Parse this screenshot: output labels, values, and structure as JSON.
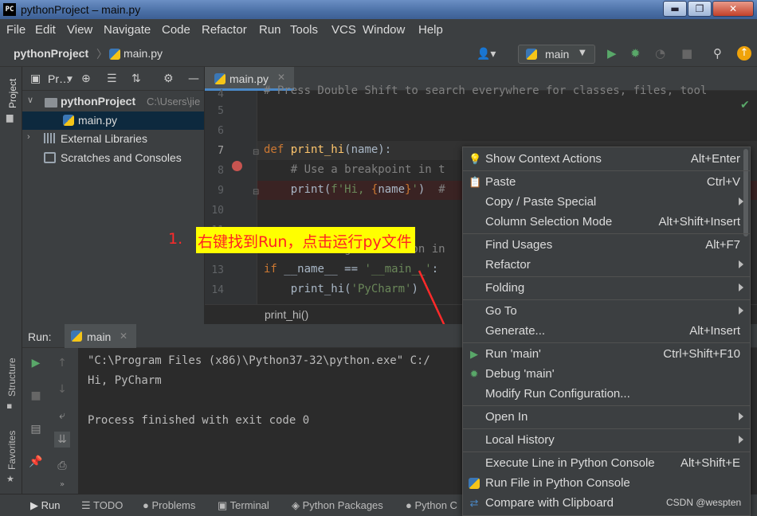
{
  "window": {
    "title": "pythonProject – main.py",
    "app_icon": "PC"
  },
  "menu": [
    "File",
    "Edit",
    "View",
    "Navigate",
    "Code",
    "Refactor",
    "Run",
    "Tools",
    "VCS",
    "Window",
    "Help"
  ],
  "navbar": {
    "project": "pythonProject",
    "file": "main.py",
    "run_config": "main"
  },
  "sidebar_tabs": {
    "project": "Project",
    "structure": "Structure",
    "favorites": "Favorites"
  },
  "project_panel": {
    "header": "Pr…",
    "tree": [
      {
        "label": "pythonProject",
        "detail": "C:\\Users\\jie",
        "type": "folder"
      },
      {
        "label": "main.py",
        "type": "python-file"
      },
      {
        "label": "External Libraries",
        "type": "libraries"
      },
      {
        "label": "Scratches and Consoles",
        "type": "scratches"
      }
    ]
  },
  "editor": {
    "tab": "main.py",
    "lines": [
      {
        "n": "4",
        "text": "# Press Double Shift to search everywhere for classes, files, tool"
      },
      {
        "n": "5",
        "text": ""
      },
      {
        "n": "6",
        "text": ""
      },
      {
        "n": "7",
        "text": "def print_hi(name):"
      },
      {
        "n": "8",
        "text": "    # Use a breakpoint in t"
      },
      {
        "n": "9",
        "text": "    print(f'Hi, {name}')  #"
      },
      {
        "n": "10",
        "text": ""
      },
      {
        "n": "11",
        "text": ""
      },
      {
        "n": "12",
        "text": "# Press the green button in"
      },
      {
        "n": "13",
        "text": "if __name__ == '__main__':"
      },
      {
        "n": "14",
        "text": "    print_hi('PyCharm')"
      }
    ],
    "breadcrumb": "print_hi()"
  },
  "annotation": {
    "number": "1.",
    "text": "右键找到Run，点击运行py文件"
  },
  "run_panel": {
    "title": "Run:",
    "tab": "main",
    "console": [
      "\"C:\\Program Files (x86)\\Python37-32\\python.exe\" C:/",
      "Hi, PyCharm",
      "",
      "Process finished with exit code 0"
    ]
  },
  "context_menu": {
    "groups": [
      [
        {
          "label": "Show Context Actions",
          "shortcut": "Alt+Enter",
          "icon": "bulb-icon"
        },
        {
          "label": "Paste",
          "shortcut": "Ctrl+V",
          "icon": "clipboard-icon"
        },
        {
          "label": "Copy / Paste Special",
          "submenu": true
        },
        {
          "label": "Column Selection Mode",
          "shortcut": "Alt+Shift+Insert"
        }
      ],
      [
        {
          "label": "Find Usages",
          "shortcut": "Alt+F7"
        },
        {
          "label": "Refactor",
          "submenu": true
        }
      ],
      [
        {
          "label": "Folding",
          "submenu": true
        }
      ],
      [
        {
          "label": "Go To",
          "submenu": true
        },
        {
          "label": "Generate...",
          "shortcut": "Alt+Insert"
        }
      ],
      [
        {
          "label": "Run 'main'",
          "shortcut": "Ctrl+Shift+F10",
          "icon": "run-icon"
        },
        {
          "label": "Debug 'main'",
          "icon": "debug-icon"
        },
        {
          "label": "Modify Run Configuration..."
        }
      ],
      [
        {
          "label": "Open In",
          "submenu": true
        }
      ],
      [
        {
          "label": "Local History",
          "submenu": true
        }
      ],
      [
        {
          "label": "Execute Line in Python Console",
          "shortcut": "Alt+Shift+E"
        },
        {
          "label": "Run File in Python Console",
          "icon": "python-icon"
        },
        {
          "label": "Compare with Clipboard",
          "icon": "compare-icon"
        }
      ]
    ]
  },
  "bottom_tabs": [
    "Run",
    "TODO",
    "Problems",
    "Terminal",
    "Python Packages",
    "Python C"
  ],
  "watermark": "CSDN @wespten",
  "colors": {
    "accent": "#4a88c7",
    "run_green": "#59a869",
    "breakpoint_red": "#c75450",
    "annotation_red": "#ff2a2a",
    "highlight_yellow": "#ffff00"
  }
}
